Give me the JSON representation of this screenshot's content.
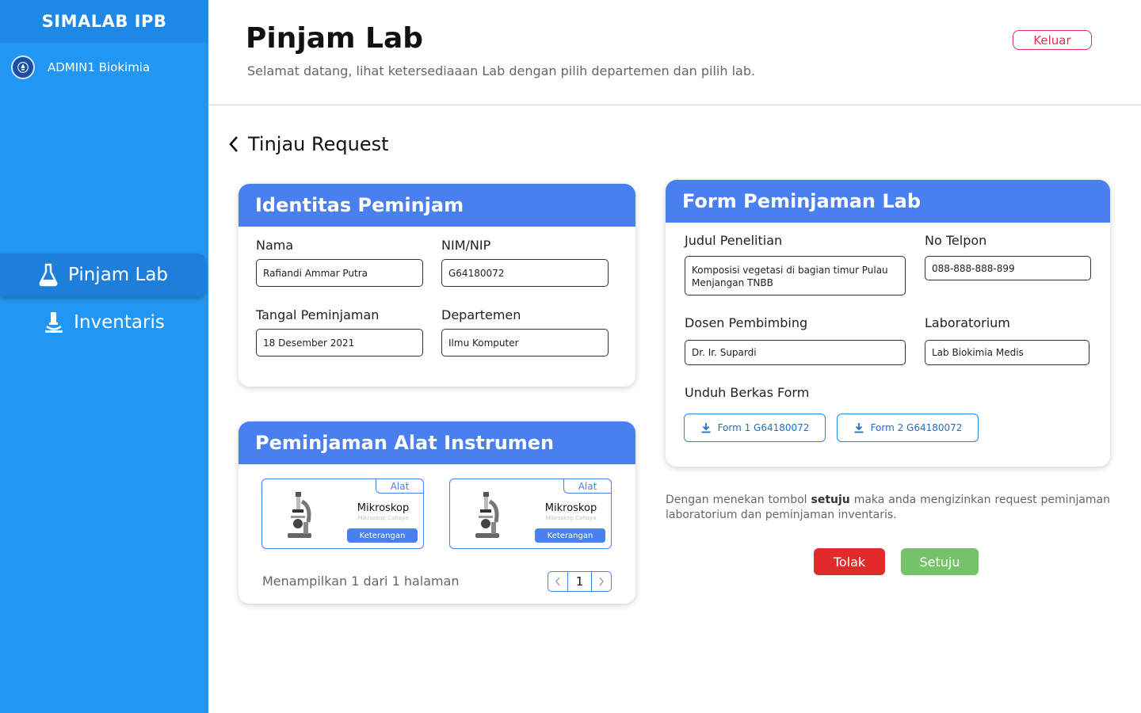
{
  "sidebar": {
    "brand": "SIMALAB IPB",
    "user_name": "ADMIN1 Biokimia",
    "items": [
      {
        "label": "Pinjam Lab",
        "icon": "flask-icon",
        "active": true
      },
      {
        "label": "Inventaris",
        "icon": "microscope-icon",
        "active": false
      }
    ]
  },
  "header": {
    "title": "Pinjam Lab",
    "subtitle": "Selamat datang, lihat ketersediaaan Lab dengan pilih departemen dan pilih lab.",
    "logout_label": "Keluar"
  },
  "section": {
    "title": "Tinjau Request"
  },
  "identitas": {
    "title": "Identitas Peminjam",
    "nama_label": "Nama",
    "nama_value": "Rafiandi Ammar Putra",
    "nim_label": "NIM/NIP",
    "nim_value": "G64180072",
    "tanggal_label": "Tangal Peminjaman",
    "tanggal_value": "18 Desember 2021",
    "departemen_label": "Departemen",
    "departemen_value": "Ilmu Komputer"
  },
  "alat": {
    "title": "Peminjaman Alat Instrumen",
    "items": [
      {
        "tag": "Alat",
        "name": "Mikroskop",
        "sub": "Mikroskop Cahaya",
        "button": "Keterangan"
      },
      {
        "tag": "Alat",
        "name": "Mikroskop",
        "sub": "Mikroskop Cahaya",
        "button": "Keterangan"
      }
    ],
    "pager_text": "Menampilkan 1 dari 1 halaman",
    "page": "1"
  },
  "form": {
    "title": "Form Peminjaman Lab",
    "judul_label": "Judul Penelitian",
    "judul_value_line1": "Komposisi vegetasi di bagian timur Pulau",
    "judul_value_line2": "Menjangan TNBB",
    "telpon_label": "No Telpon",
    "telpon_value": "088-888-888-899",
    "dosen_label": "Dosen Pembimbing",
    "dosen_value": "Dr. Ir. Supardi",
    "lab_label": "Laboratorium",
    "lab_value": "Lab Biokimia Medis",
    "unduh_label": "Unduh Berkas Form",
    "download1": "Form 1 G64180072",
    "download2": "Form 2 G64180072"
  },
  "consent": {
    "before": "Dengan menekan tombol ",
    "bold": "setuju",
    "after": " maka anda mengizinkan request peminjaman laboratorium dan peminjaman inventaris."
  },
  "actions": {
    "reject_label": "Tolak",
    "accept_label": "Setuju"
  },
  "colors": {
    "sidebar": "#2196f3",
    "card_header": "#4a7ff0",
    "reject": "#e12b2b",
    "accept": "#76c26b",
    "logout": "#e0314a"
  }
}
